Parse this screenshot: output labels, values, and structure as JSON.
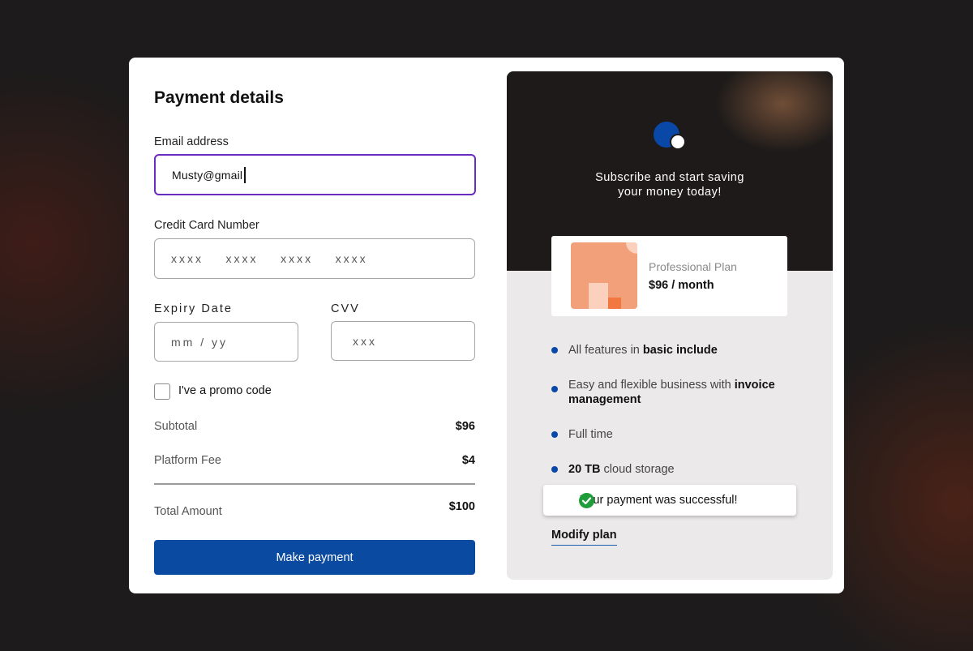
{
  "payment": {
    "title": "Payment details",
    "email_label": "Email address",
    "email_value": "Musty@gmail",
    "card_label": "Credit Card Number",
    "card_placeholder": "xxxx    xxxx    xxxx    xxxx",
    "expiry_label": "Expiry Date",
    "expiry_placeholder": "mm / yy",
    "cvv_label": "CVV",
    "cvv_placeholder": "xxx",
    "promo_label": "I've a promo code",
    "promo_checked": false,
    "subtotal_label": "Subtotal",
    "subtotal_value": "$96",
    "fee_label": "Platform Fee",
    "fee_value": "$4",
    "total_label": "Total Amount",
    "total_value": "$100",
    "pay_button": "Make payment"
  },
  "summary": {
    "tagline_line1": "Subscribe and start saving",
    "tagline_line2": "your money today!",
    "plan_name": "Professional Plan",
    "plan_price": "$96 / month",
    "features": [
      {
        "text": "All features in ",
        "bold": "basic include"
      },
      {
        "text": "Easy and flexible business with ",
        "bold": "invoice management"
      },
      {
        "text": "Full time",
        "bold": ""
      },
      {
        "bold": "20 TB",
        "text": " cloud storage"
      }
    ],
    "toast": "Your payment was successful!",
    "modify_link": "Modify plan"
  },
  "colors": {
    "accent": "#0a4aa1",
    "focus_border": "#6a2bc2",
    "success": "#1f9d3a",
    "dark_panel": "#1d1a19"
  },
  "icons": [
    "brand-logo-icon",
    "checkmark-circle-icon"
  ]
}
